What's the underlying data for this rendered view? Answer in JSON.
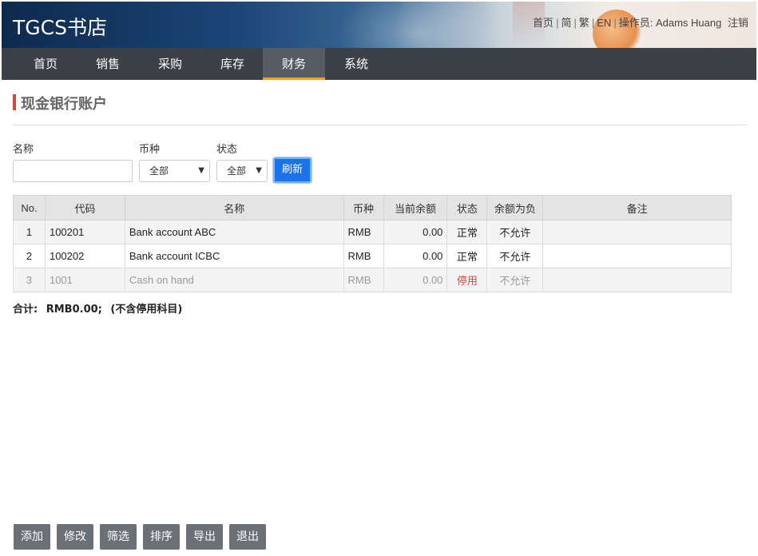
{
  "app": {
    "title": "TGCS书店"
  },
  "top_links": {
    "home": "首页",
    "simplified": "简",
    "traditional": "繁",
    "english": "EN",
    "operator_label": "操作员:",
    "operator_name": "Adams Huang",
    "logout": "注销"
  },
  "nav": {
    "items": [
      {
        "label": "首页"
      },
      {
        "label": "销售"
      },
      {
        "label": "采购"
      },
      {
        "label": "库存"
      },
      {
        "label": "财务"
      },
      {
        "label": "系统"
      }
    ],
    "active": "财务"
  },
  "page": {
    "title": "现金银行账户"
  },
  "filters": {
    "name_label": "名称",
    "name_value": "",
    "currency_label": "币种",
    "currency_value": "全部",
    "status_label": "状态",
    "status_value": "全部",
    "refresh_label": "刷新"
  },
  "table": {
    "headers": [
      "No.",
      "代码",
      "名称",
      "币种",
      "当前余额",
      "状态",
      "余额为负",
      "备注"
    ],
    "rows": [
      {
        "no": "1",
        "code": "100201",
        "name": "Bank account ABC",
        "currency": "RMB",
        "balance": "0.00",
        "status": "正常",
        "negative": "不允许",
        "note": ""
      },
      {
        "no": "2",
        "code": "100202",
        "name": "Bank account ICBC",
        "currency": "RMB",
        "balance": "0.00",
        "status": "正常",
        "negative": "不允许",
        "note": ""
      },
      {
        "no": "3",
        "code": "1001",
        "name": "Cash on hand",
        "currency": "RMB",
        "balance": "0.00",
        "status": "停用",
        "negative": "不允许",
        "note": ""
      }
    ]
  },
  "summary": {
    "label": "合计:",
    "total": "RMB0.00;",
    "note": "(不含停用科目)"
  },
  "actions": {
    "add": "添加",
    "edit": "修改",
    "filter": "筛选",
    "sort": "排序",
    "export": "导出",
    "exit": "退出"
  },
  "colors": {
    "nav_bg": "#3b3f46",
    "nav_active_underline": "#f0a500",
    "accent_blue": "#1a73e8",
    "title_bar_red": "#d9443f",
    "disabled_status": "#d9443f",
    "button_gray": "#6b7077"
  }
}
